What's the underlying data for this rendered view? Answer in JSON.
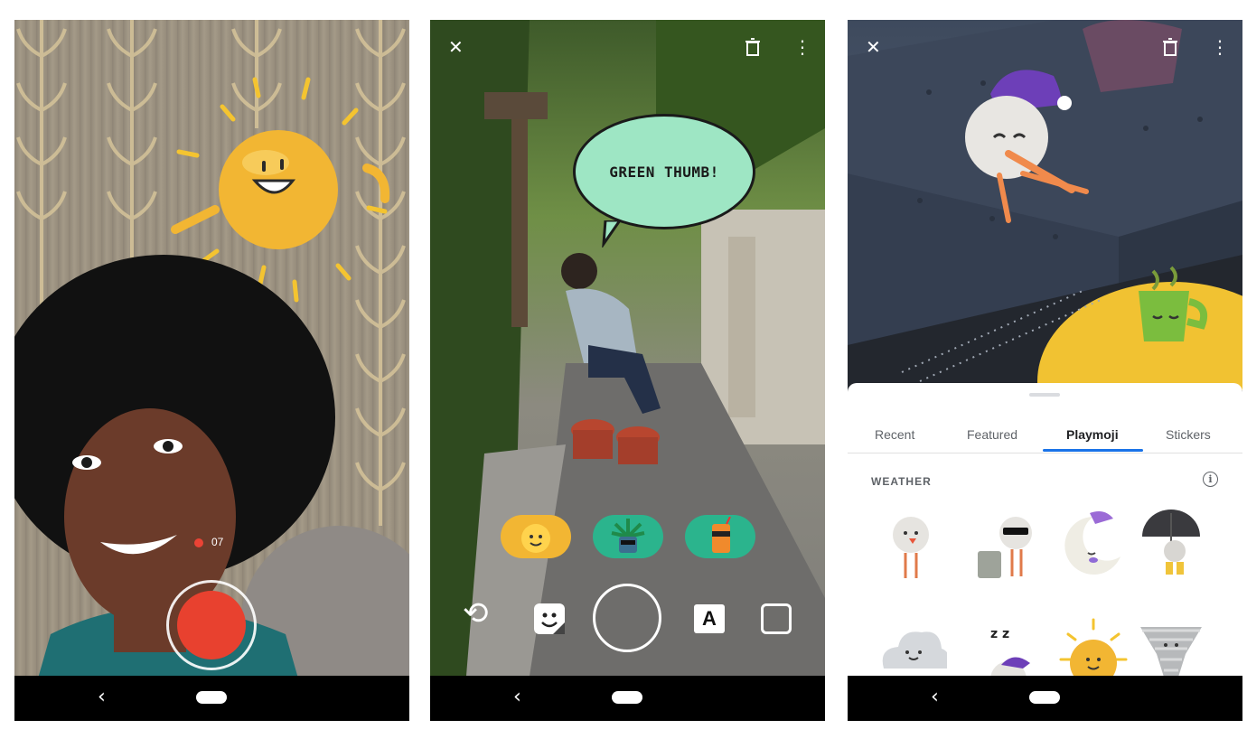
{
  "screen1": {
    "recording_time": "07",
    "nav_back": "‹"
  },
  "screen2": {
    "bubble_text": "GREEN THUMB!",
    "close_icon": "✕",
    "delete_icon": "🗑",
    "more_icon": "⋮",
    "sticker_suggestions": [
      "sun-sticker",
      "plant-sticker",
      "juice-sticker"
    ],
    "flip_camera_icon": "⟲",
    "text_tool_label": "A",
    "nav_back": "‹"
  },
  "screen3": {
    "close_icon": "✕",
    "delete_icon": "🗑",
    "more_icon": "⋮",
    "tabs": [
      {
        "label": "Recent"
      },
      {
        "label": "Featured"
      },
      {
        "label": "Playmoji"
      },
      {
        "label": "Stickers"
      }
    ],
    "active_tab": "Playmoji",
    "section_title": "WEATHER",
    "info_icon": "i",
    "nav_back": "‹"
  },
  "colors": {
    "record_red": "#e8412f",
    "tab_accent": "#1a73e8",
    "bubble_mint": "#9ee6c4",
    "sticker_yellow": "#f2b633",
    "sticker_teal": "#2bb48d"
  }
}
